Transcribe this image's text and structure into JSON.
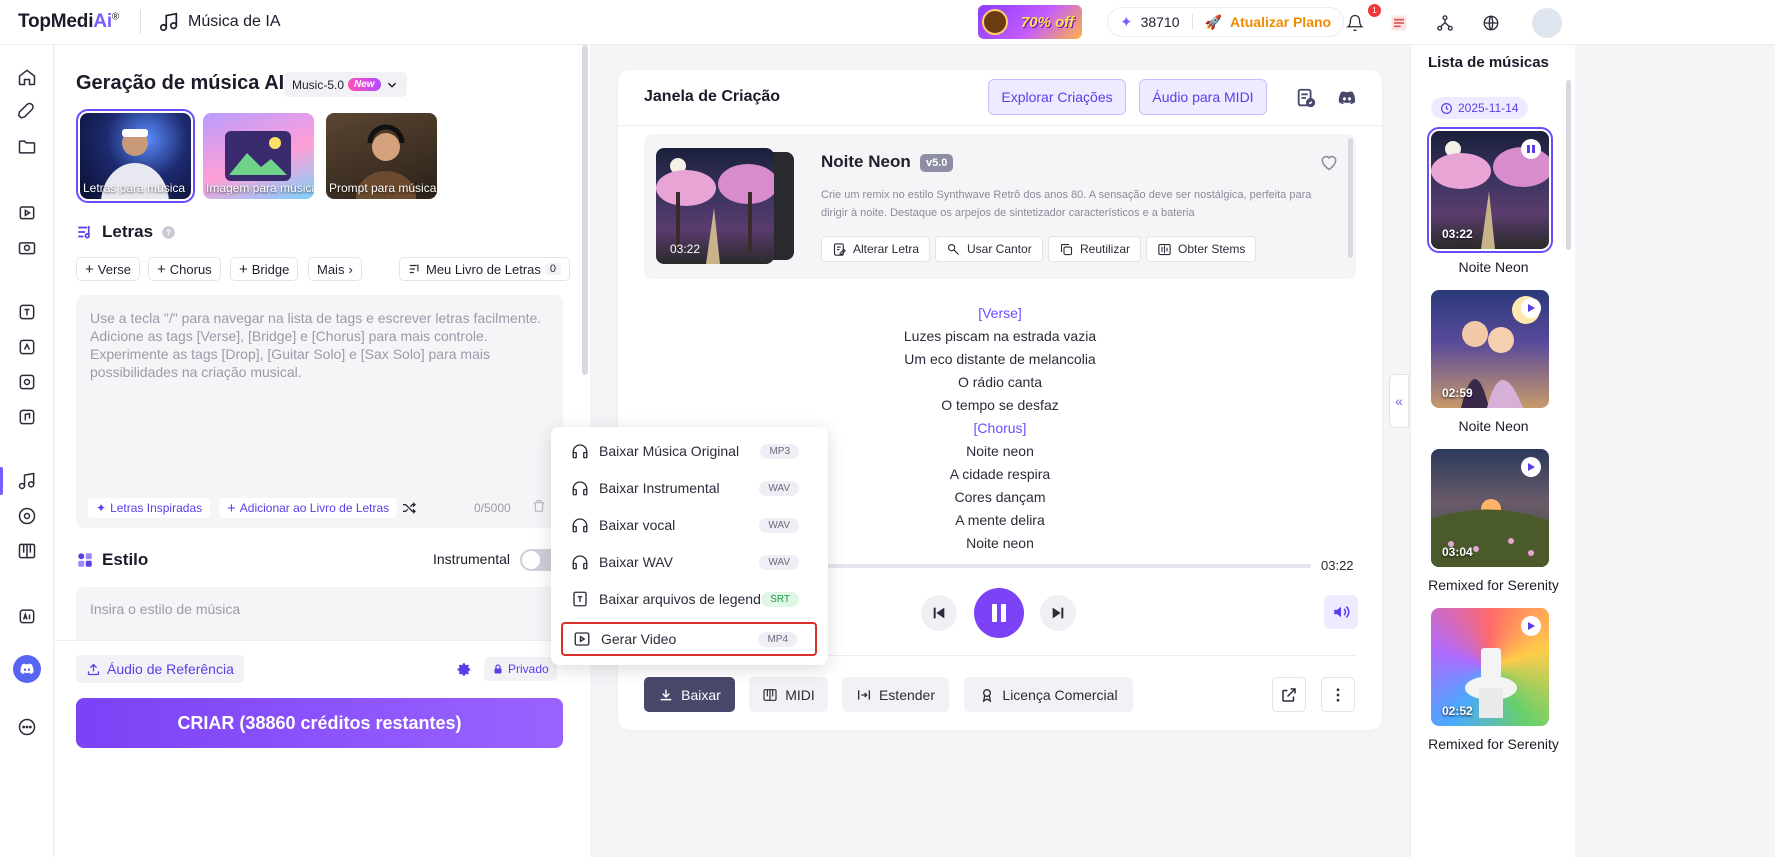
{
  "topbar": {
    "logo_main": "TopMedi",
    "logo_ai": "Ai",
    "logo_mark": "®",
    "app_title": "Música de IA",
    "promo_text": "70% off",
    "credits": "38710",
    "upgrade_label": "Atualizar Plano",
    "notification_count": "1"
  },
  "left_panel": {
    "title": "Geração de música AI",
    "model_label": "Music-5.0",
    "model_badge": "New",
    "modes": [
      {
        "label": "Letras para música"
      },
      {
        "label": "Imagem para música"
      },
      {
        "label": "Prompt para música"
      }
    ],
    "lyrics_heading": "Letras",
    "chips": [
      "Verse",
      "Chorus",
      "Bridge",
      "Mais"
    ],
    "lyrics_book_label": "Meu Livro de Letras",
    "lyrics_book_count": "0",
    "lyrics_placeholder": "Use a tecla \"/\" para navegar na lista de tags e escrever letras facilmente. Adicione as tags [Verse], [Bridge] e [Chorus] para mais controle. Experimente as tags [Drop], [Guitar Solo] e [Sax Solo] para mais possibilidades na criação musical.",
    "inspired_label": "Letras Inspiradas",
    "add_to_book_label": "Adicionar ao Livro de Letras",
    "char_count": "0/5000",
    "style_heading": "Estilo",
    "instrumental_label": "Instrumental",
    "instrumental_on": false,
    "style_placeholder": "Insira o estilo de música",
    "reference_audio_label": "Áudio de Referência",
    "private_label": "Privado",
    "create_label": "CRIAR (38860 créditos restantes)"
  },
  "main": {
    "title": "Janela de Criação",
    "explore_label": "Explorar Criações",
    "midi_audio_label": "Áudio para MIDI",
    "song": {
      "name": "Noite Neon",
      "version": "v5.0",
      "duration": "03:22",
      "description": "Crie um remix no estilo Synthwave Retrô dos anos 80. A sensação deve ser nostálgica, perfeita para dirigir à noite. Destaque os arpejos de sintetizador característicos e a bateria",
      "actions": [
        "Alterar Letra",
        "Usar Cantor",
        "Reutilizar",
        "Obter Stems"
      ]
    },
    "lyrics": [
      {
        "text": "[Verse]",
        "tag": true
      },
      {
        "text": "Luzes piscam na estrada vazia",
        "tag": false
      },
      {
        "text": "Um eco distante de melancolia",
        "tag": false
      },
      {
        "text": "O rádio canta",
        "tag": false
      },
      {
        "text": "O tempo se desfaz",
        "tag": false
      },
      {
        "text": "[Chorus]",
        "tag": true
      },
      {
        "text": "Noite neon",
        "tag": false
      },
      {
        "text": "A cidade respira",
        "tag": false
      },
      {
        "text": "Cores dançam",
        "tag": false
      },
      {
        "text": "A mente delira",
        "tag": false
      },
      {
        "text": "Noite neon",
        "tag": false
      }
    ],
    "progress_total": "03:22",
    "bottom_buttons": {
      "download": "Baixar",
      "midi": "MIDI",
      "extend": "Estender",
      "license": "Licença Comercial"
    }
  },
  "download_menu": [
    {
      "label": "Baixar Música Original",
      "format": "MP3",
      "icon": "headphones-icon"
    },
    {
      "label": "Baixar Instrumental",
      "format": "WAV",
      "icon": "headphones-icon"
    },
    {
      "label": "Baixar vocal",
      "format": "WAV",
      "icon": "headphones-icon"
    },
    {
      "label": "Baixar WAV",
      "format": "WAV",
      "icon": "headphones-icon"
    },
    {
      "label": "Baixar arquivos de legenda",
      "format": "SRT",
      "icon": "subtitle-file-icon"
    },
    {
      "label": "Gerar Video",
      "format": "MP4",
      "icon": "video-icon",
      "highlighted": true
    }
  ],
  "right_panel": {
    "title": "Lista de músicas",
    "date": "2025-11-14",
    "songs": [
      {
        "name": "Noite Neon",
        "duration": "03:22",
        "playing": true
      },
      {
        "name": "Noite Neon",
        "duration": "02:59",
        "playing": false
      },
      {
        "name": "Remixed for Serenity",
        "duration": "03:04",
        "playing": false
      },
      {
        "name": "Remixed for Serenity",
        "duration": "02:52",
        "playing": false
      }
    ]
  },
  "colors": {
    "accent": "#7b5cff",
    "accent_dark": "#5a3ee8",
    "download_btn": "#48486b",
    "highlight_border": "#d9302c",
    "srt_badge": "#1f9a47"
  }
}
